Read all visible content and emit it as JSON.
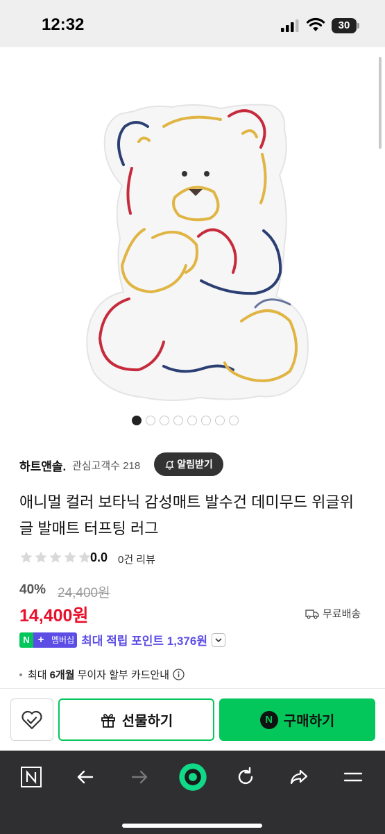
{
  "status_bar": {
    "time": "12:32",
    "battery": "30"
  },
  "gallery": {
    "image_count": 8,
    "active_index": 0
  },
  "store": {
    "name": "하트앤솔.",
    "followers": "관심고객수 218",
    "alarm_label": "알림받기"
  },
  "product": {
    "title": "애니멀 컬러 보타닉 감성매트 발수건 데미무드 위글위글 발매트 터프팅 러그",
    "rating": "0.0",
    "review_count": "0건 리뷰",
    "discount": "40%",
    "original_price": "24,400원",
    "sale_price": "14,400원",
    "shipping": "무료배송"
  },
  "membership": {
    "badge_n": "N",
    "badge_plus": "+",
    "badge_label": "멤버십",
    "text": "최대 적립 포인트 1,376원"
  },
  "installment": {
    "prefix": "최대",
    "bold": "6개월",
    "suffix": "무이자 할부 카드안내"
  },
  "actions": {
    "gift_label": "선물하기",
    "buy_label": "구매하기",
    "npay_letter": "N"
  },
  "colors": {
    "naver_green": "#03c75a",
    "sale_red": "#e8112d",
    "membership_purple": "#5c4ee5",
    "toolbar_bg": "#2f2f31"
  }
}
